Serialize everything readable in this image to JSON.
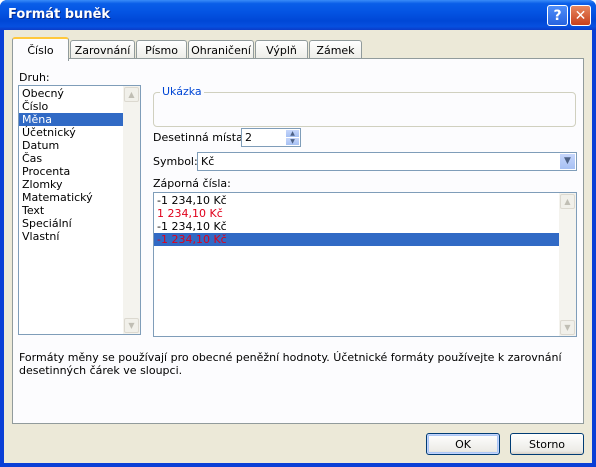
{
  "window": {
    "title": "Formát buněk"
  },
  "tabs": [
    {
      "label": "Číslo",
      "active": true
    },
    {
      "label": "Zarovnání"
    },
    {
      "label": "Písmo"
    },
    {
      "label": "Ohraničení"
    },
    {
      "label": "Výplň"
    },
    {
      "label": "Zámek"
    }
  ],
  "category": {
    "label": "Druh:",
    "items": [
      "Obecný",
      "Číslo",
      "Měna",
      "Účetnický",
      "Datum",
      "Čas",
      "Procenta",
      "Zlomky",
      "Matematický",
      "Text",
      "Speciální",
      "Vlastní"
    ],
    "selected": "Měna"
  },
  "sample": {
    "label": "Ukázka",
    "value": ""
  },
  "decimals": {
    "label": "Desetinná místa:",
    "value": "2"
  },
  "symbol": {
    "label": "Symbol:",
    "value": "Kč"
  },
  "negative": {
    "label": "Záporná čísla:",
    "items": [
      {
        "text": "-1 234,10 Kč",
        "color": "#000000"
      },
      {
        "text": "1 234,10 Kč",
        "color": "#e0001b"
      },
      {
        "text": "-1 234,10 Kč",
        "color": "#000000"
      },
      {
        "text": "-1 234,10 Kč",
        "color": "#e0001b",
        "selected": true
      }
    ]
  },
  "description": "Formáty měny se používají pro obecné peněžní hodnoty. Účetnické formáty používejte k zarovnání desetinných čárek ve sloupci.",
  "buttons": {
    "ok": "OK",
    "cancel": "Storno"
  },
  "colors": {
    "selection": "#316ac5",
    "negative_red": "#e0001b",
    "group_title": "#0046d5"
  }
}
